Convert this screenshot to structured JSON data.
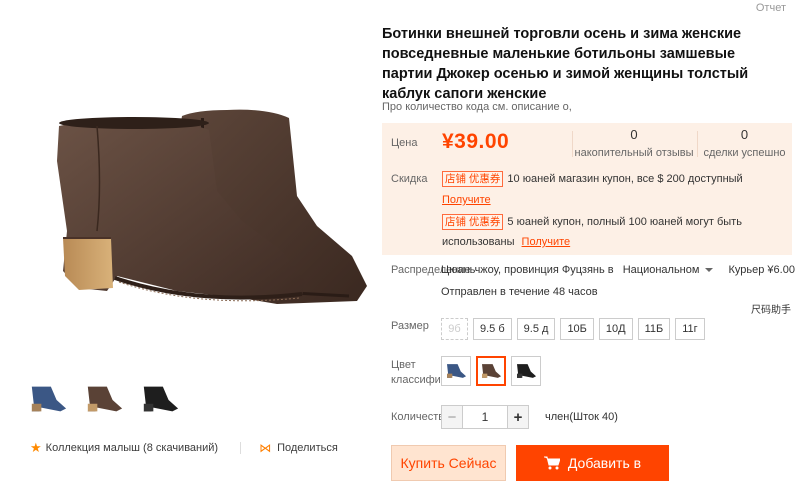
{
  "report_label": "Отчет",
  "product": {
    "title": "Ботинки внешней торговли осень и зима женские повседневные маленькие ботильоны замшевые партии Джокер осенью и зимой женщины толстый каблук сапоги женские",
    "subtitle": "Про количество кода см. описание о,"
  },
  "price": {
    "label": "Цена",
    "value": "¥39.00",
    "reviews_count": "0",
    "reviews_label": "накопительный отзывы",
    "deals_count": "0",
    "deals_label": "сделки успешно"
  },
  "discount": {
    "label": "Скидка",
    "coupons": [
      {
        "tag": "店铺 优惠券",
        "text": "10 юаней магазин купон, все $ 200 доступный",
        "get_label": "Получите"
      },
      {
        "tag": "店铺 优惠券",
        "text": "5 юаней купон, полный 100 юаней могут быть",
        "text2": "использованы",
        "get_label": "Получите"
      }
    ]
  },
  "shipping": {
    "label": "Распределение",
    "from": "Цюаньчжоу, провинция Фуцзянь в",
    "scope": "Национальном",
    "courier": "Курьер ¥6.00",
    "dispatch": "Отправлен в течение 48 часов"
  },
  "size_guide": "尺码助手",
  "sizes": {
    "label": "Размер",
    "options": [
      "9б",
      "9.5 б",
      "9.5 д",
      "10Б",
      "10Д",
      "11Б",
      "11г"
    ]
  },
  "colors": {
    "label_line1": "Цвет",
    "label_line2": "классифика",
    "options": [
      {
        "name": "blue-boot",
        "color": "#3b5785"
      },
      {
        "name": "brown-boot",
        "color": "#5a4236"
      },
      {
        "name": "black-boot",
        "color": "#222222"
      }
    ]
  },
  "quantity": {
    "label": "Количество",
    "value": "1",
    "stock": "член(Шток 40)"
  },
  "buttons": {
    "buy_now": "Купить Сейчас",
    "add_to_cart": "Добавить в"
  },
  "gallery": {
    "favorite": "Коллекция малыш (8 скачиваний)",
    "share": "Поделиться"
  },
  "colors_theme": {
    "accent": "#ff4400",
    "price_bg": "#fdf0e6"
  }
}
